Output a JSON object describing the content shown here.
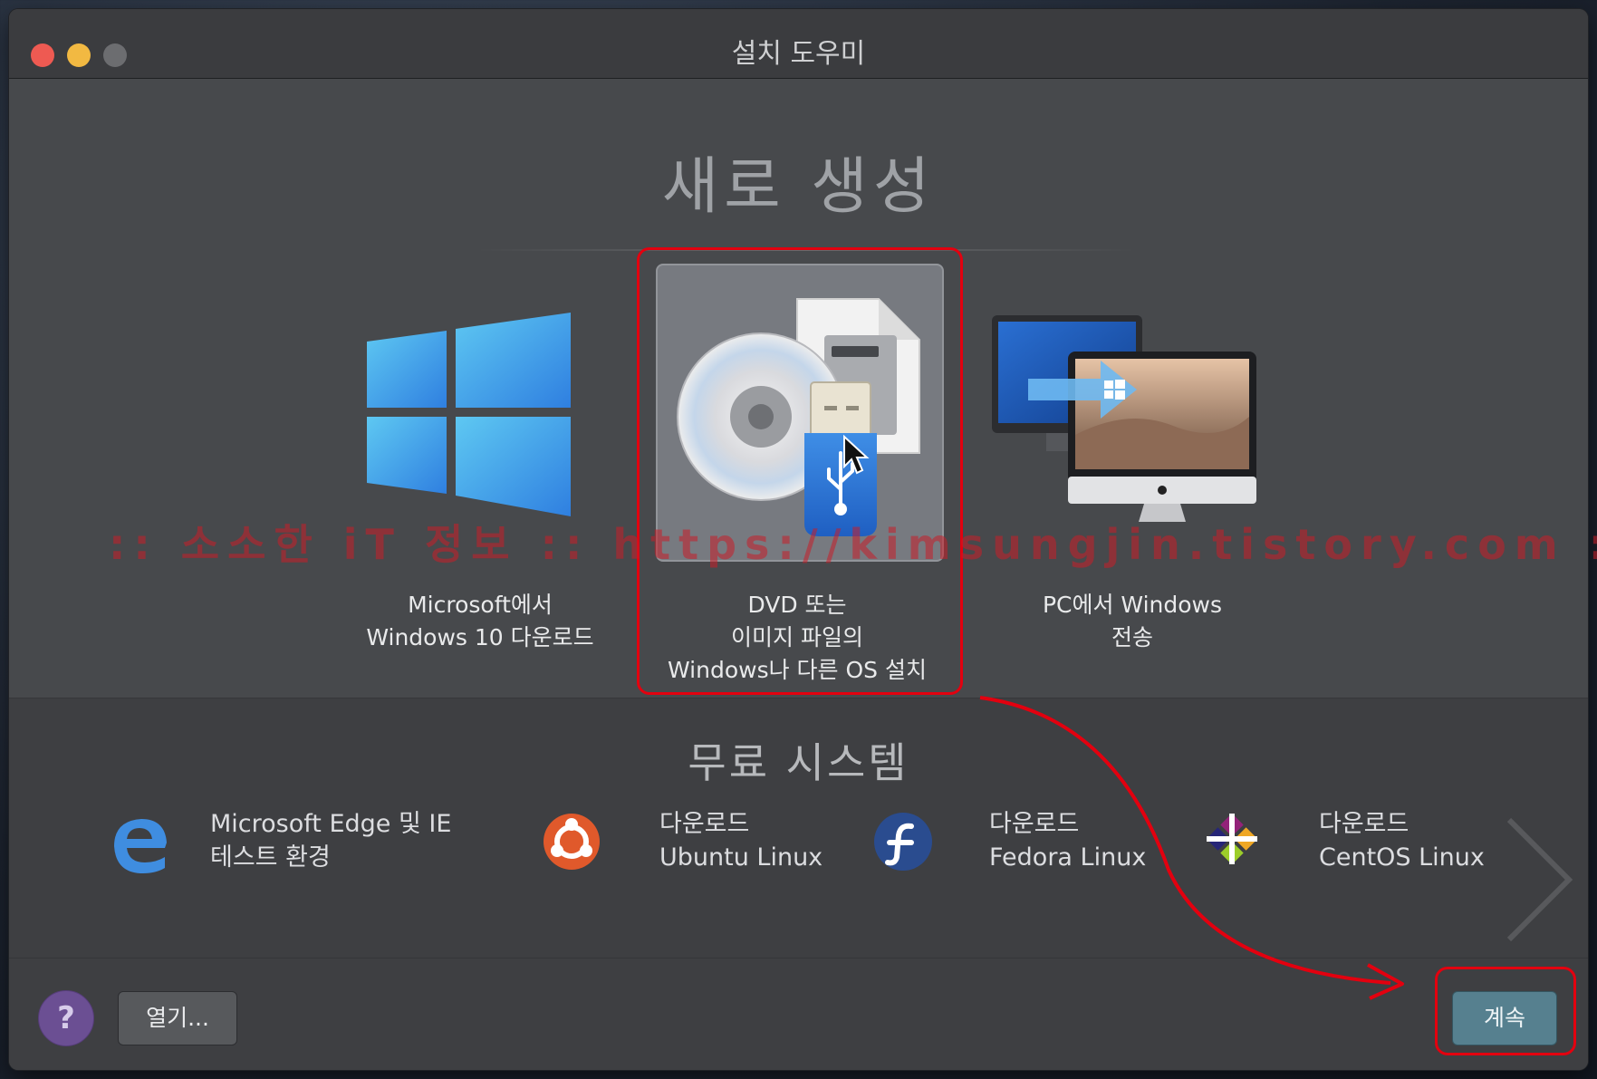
{
  "window": {
    "title": "설치 도우미"
  },
  "main": {
    "heading": "새로 생성",
    "cards": [
      {
        "lines": [
          "Microsoft에서",
          "Windows 10 다운로드"
        ]
      },
      {
        "lines": [
          "DVD 또는",
          "이미지 파일의",
          "Windows나 다른 OS 설치"
        ]
      },
      {
        "lines": [
          "PC에서 Windows",
          "전송"
        ]
      }
    ]
  },
  "free": {
    "heading": "무료 시스템",
    "items": [
      {
        "lines": [
          "Microsoft Edge 및 IE",
          "테스트 환경"
        ]
      },
      {
        "lines": [
          "다운로드",
          "Ubuntu Linux"
        ]
      },
      {
        "lines": [
          "다운로드",
          "Fedora Linux"
        ]
      },
      {
        "lines": [
          "다운로드",
          "CentOS Linux"
        ]
      }
    ]
  },
  "footer": {
    "help_label": "?",
    "open_label": "열기...",
    "continue_label": "계속"
  },
  "watermark": ":: 소소한 iT 정보 :: https://kimsungjin.tistory.com ::",
  "colors": {
    "accent": "#56808f",
    "annotation": "#e3000f",
    "help": "#6b4f93"
  }
}
